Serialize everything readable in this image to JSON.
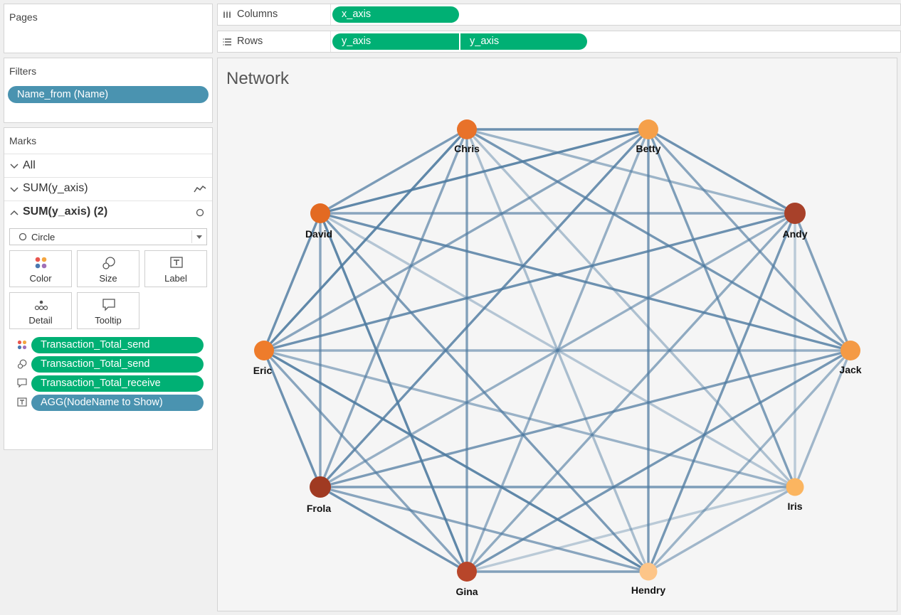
{
  "pages": {
    "title": "Pages"
  },
  "filters": {
    "title": "Filters",
    "pill": "Name_from (Name)"
  },
  "marks": {
    "title": "Marks",
    "rows": [
      {
        "label": "All",
        "icon": "chevron-down-icon"
      },
      {
        "label": "SUM(y_axis)",
        "icon": "line-chart-icon"
      },
      {
        "label": "SUM(y_axis) (2)",
        "icon": "circle-icon"
      }
    ],
    "mark_type": "Circle",
    "buttons": [
      "Color",
      "Size",
      "Label",
      "Detail",
      "Tooltip"
    ],
    "fields": [
      {
        "label": "Transaction_Total_send",
        "icon": "color-dots-icon",
        "color": "#00b074"
      },
      {
        "label": "Transaction_Total_send",
        "icon": "size-icon",
        "color": "#00b074"
      },
      {
        "label": "Transaction_Total_receive",
        "icon": "tooltip-icon",
        "color": "#00b074"
      },
      {
        "label": "AGG(NodeName to Show)",
        "icon": "label-icon",
        "color": "#4a93b0"
      }
    ]
  },
  "shelves": {
    "columns": {
      "label": "Columns",
      "pills": [
        "x_axis"
      ]
    },
    "rows": {
      "label": "Rows",
      "pills": [
        "y_axis",
        "y_axis"
      ]
    }
  },
  "view": {
    "title": "Network",
    "nodes": [
      {
        "name": "Chris",
        "color": "#e8722a"
      },
      {
        "name": "Betty",
        "color": "#f5a04a"
      },
      {
        "name": "Andy",
        "color": "#a8412a"
      },
      {
        "name": "Jack",
        "color": "#f49a45"
      },
      {
        "name": "Iris",
        "color": "#fbb560"
      },
      {
        "name": "Hendry",
        "color": "#fdc588"
      },
      {
        "name": "Gina",
        "color": "#b8462a"
      },
      {
        "name": "Frola",
        "color": "#a03a22"
      },
      {
        "name": "Eric",
        "color": "#ee7c2b"
      },
      {
        "name": "David",
        "color": "#e36a22"
      }
    ]
  }
}
